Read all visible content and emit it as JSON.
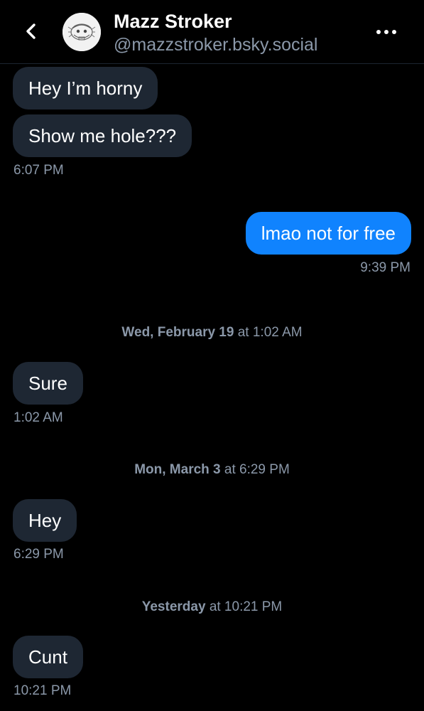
{
  "header": {
    "back_icon": "chevron-left-icon",
    "contact_name": "Mazz Stroker",
    "contact_handle": "@mazzstroker.bsky.social",
    "more_icon": "ellipsis-icon"
  },
  "colors": {
    "background": "#000000",
    "incoming_bubble": "#1e2733",
    "outgoing_bubble": "#1083fe",
    "muted_text": "#8b98a9"
  },
  "messages": [
    {
      "direction": "in",
      "text": "Hey I’m horny"
    },
    {
      "direction": "in",
      "text": "Show me hole???",
      "time": "6:07 PM"
    },
    {
      "direction": "out",
      "text": "lmao not for free",
      "time": "9:39 PM"
    },
    {
      "date_day": "Wed, February 19",
      "date_rest": "at 1:02 AM"
    },
    {
      "direction": "in",
      "text": "Sure",
      "time": "1:02 AM"
    },
    {
      "date_day": "Mon, March 3",
      "date_rest": "at 6:29 PM"
    },
    {
      "direction": "in",
      "text": "Hey",
      "time": "6:29 PM"
    },
    {
      "date_day": "Yesterday",
      "date_rest": "at 10:21 PM"
    },
    {
      "direction": "in",
      "text": "Cunt",
      "time": "10:21 PM"
    }
  ]
}
